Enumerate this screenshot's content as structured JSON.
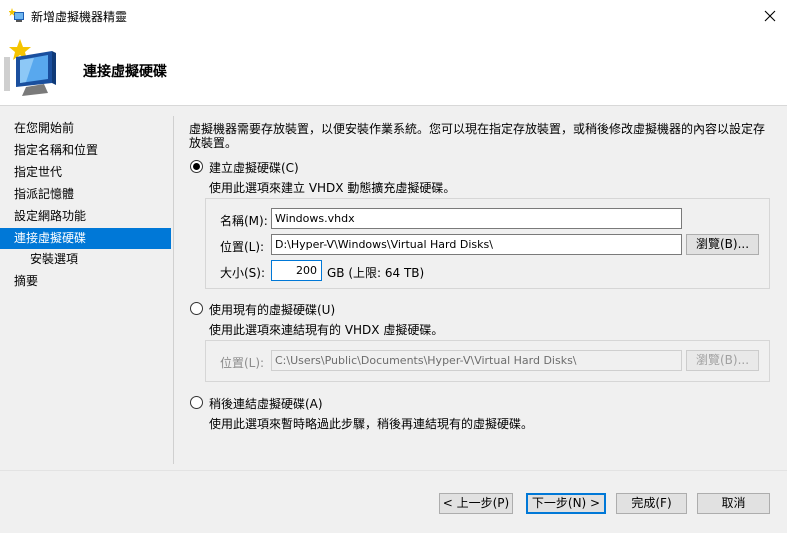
{
  "window": {
    "title": "新增虛擬機器精靈"
  },
  "header": {
    "title": "連接虛擬硬碟"
  },
  "nav": {
    "items": [
      {
        "label": "在您開始前"
      },
      {
        "label": "指定名稱和位置"
      },
      {
        "label": "指定世代"
      },
      {
        "label": "指派記憶體"
      },
      {
        "label": "設定網路功能"
      },
      {
        "label": "連接虛擬硬碟",
        "selected": true
      },
      {
        "label": "安裝選項"
      },
      {
        "label": "摘要"
      }
    ]
  },
  "content": {
    "description": "虛擬機器需要存放裝置，以便安裝作業系統。您可以現在指定存放裝置，或稍後修改虛擬機器的內容以設定存放裝置。",
    "option_create": {
      "label": "建立虛擬硬碟(C)",
      "selected": true,
      "description": "使用此選項來建立 VHDX 動態擴充虛擬硬碟。",
      "name_label": "名稱(M):",
      "name_value": "Windows.vhdx",
      "location_label": "位置(L):",
      "location_value": "D:\\Hyper-V\\Windows\\Virtual Hard Disks\\",
      "browse_label": "瀏覽(B)...",
      "size_label": "大小(S):",
      "size_value": "200",
      "size_unit": "GB (上限: 64 TB)"
    },
    "option_existing": {
      "label": "使用現有的虛擬硬碟(U)",
      "selected": false,
      "description": "使用此選項來連結現有的 VHDX 虛擬硬碟。",
      "location_label": "位置(L):",
      "location_value": "C:\\Users\\Public\\Documents\\Hyper-V\\Virtual Hard Disks\\",
      "browse_label": "瀏覽(B)..."
    },
    "option_later": {
      "label": "稍後連結虛擬硬碟(A)",
      "selected": false,
      "description": "使用此選項來暫時略過此步驟，稍後再連結現有的虛擬硬碟。"
    }
  },
  "buttons": {
    "previous": "< 上一步(P)",
    "next": "下一步(N) >",
    "finish": "完成(F)",
    "cancel": "取消"
  },
  "colors": {
    "accent": "#0078d7"
  }
}
